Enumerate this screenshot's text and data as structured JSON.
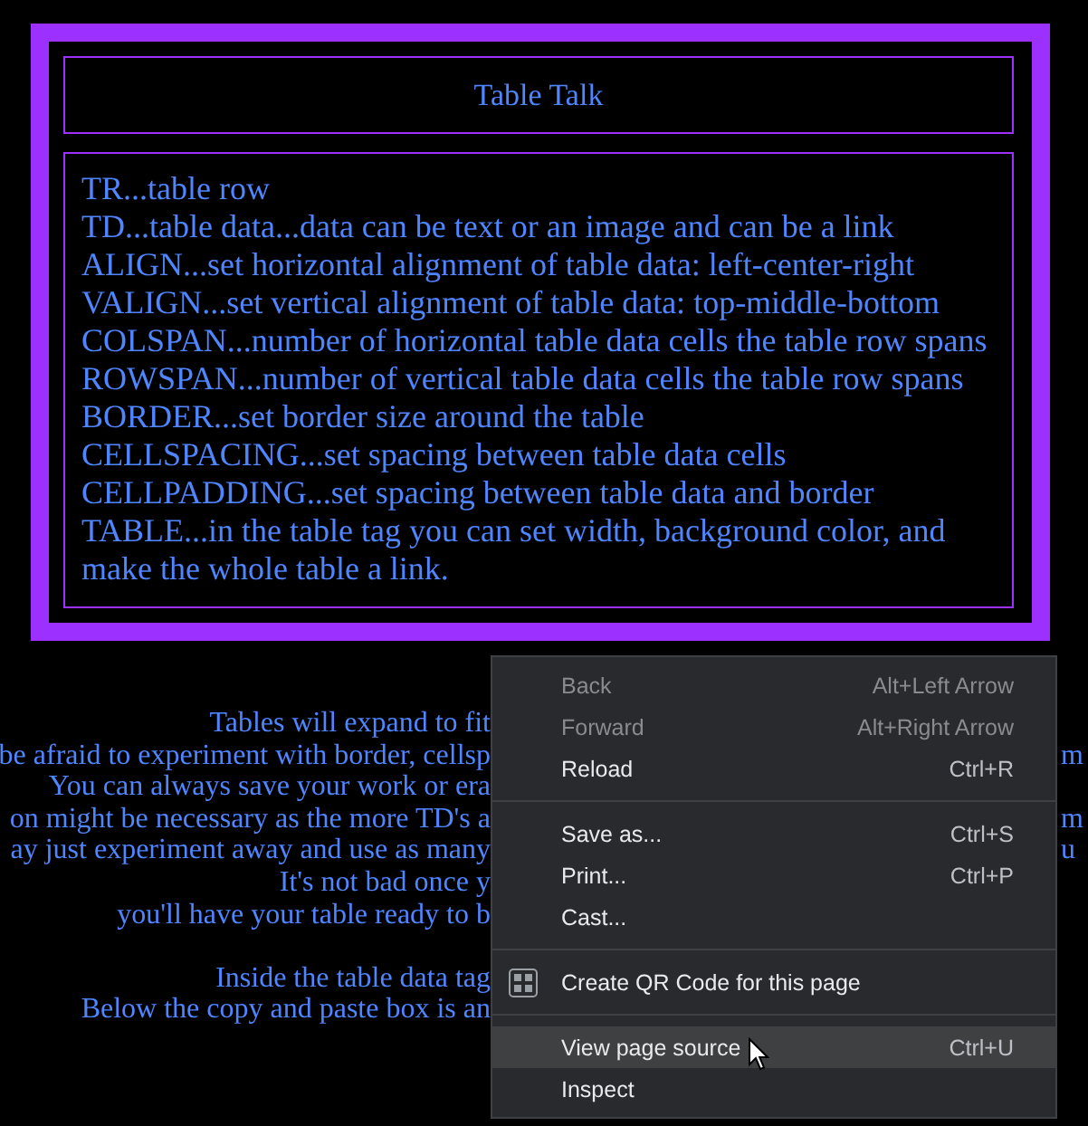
{
  "table": {
    "title": "Table Talk",
    "entries": [
      "TR...table row",
      "TD...table data...data can be text or an image and can be a link",
      "ALIGN...set horizontal alignment of table data: left-center-right",
      "VALIGN...set vertical alignment of table data: top-middle-bottom",
      "COLSPAN...number of horizontal table data cells the table row spans",
      "ROWSPAN...number of vertical table data cells the table row spans",
      "BORDER...set border size around the table",
      "CELLSPACING...set spacing between table data cells",
      "CELLPADDING...set spacing between table data and border",
      "TABLE...in the table tag you can set width, background color, and make the whole table a link."
    ]
  },
  "paragraphs": [
    [
      {
        "left": "Tables will expand to fit"
      },
      {
        "left": "be afraid to experiment with border, cellsp",
        "right": "m"
      },
      {
        "left": "You can always save your work or era"
      },
      {
        "left": "on might be necessary as the more TD's a",
        "right": "m"
      },
      {
        "left": "ay just experiment away and use as many",
        "right": "u"
      },
      {
        "left": "It's not bad once y"
      },
      {
        "left": "you'll have your table ready to b"
      }
    ],
    [
      {
        "left": "Inside the table data tag"
      },
      {
        "left": "Below the copy and paste box is an"
      }
    ]
  ],
  "context_menu": {
    "sections": [
      [
        {
          "kind": "plain",
          "label": "Back",
          "shortcut": "Alt+Left Arrow",
          "disabled": true,
          "selected": false
        },
        {
          "kind": "plain",
          "label": "Forward",
          "shortcut": "Alt+Right Arrow",
          "disabled": true,
          "selected": false
        },
        {
          "kind": "plain",
          "label": "Reload",
          "shortcut": "Ctrl+R",
          "disabled": false,
          "selected": false
        }
      ],
      [
        {
          "kind": "plain",
          "label": "Save as...",
          "shortcut": "Ctrl+S",
          "disabled": false,
          "selected": false
        },
        {
          "kind": "plain",
          "label": "Print...",
          "shortcut": "Ctrl+P",
          "disabled": false,
          "selected": false
        },
        {
          "kind": "plain",
          "label": "Cast...",
          "disabled": false,
          "selected": false
        }
      ],
      [
        {
          "kind": "qr",
          "label": "Create QR Code for this page",
          "disabled": false,
          "selected": false
        }
      ],
      [
        {
          "kind": "plain",
          "label": "View page source",
          "shortcut": "Ctrl+U",
          "disabled": false,
          "selected": true
        },
        {
          "kind": "plain",
          "label": "Inspect",
          "disabled": false,
          "selected": false
        }
      ]
    ]
  }
}
